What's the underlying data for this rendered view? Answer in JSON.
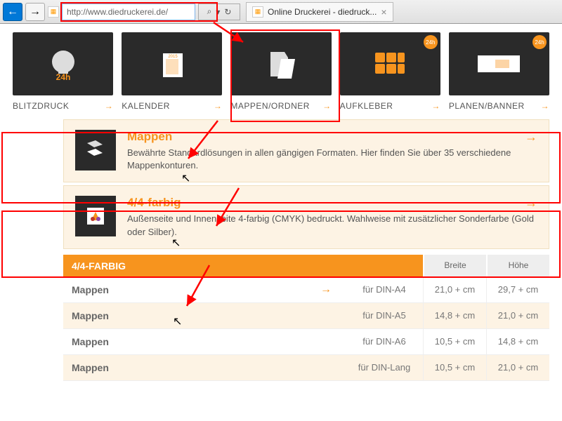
{
  "browser": {
    "url": "http://www.diedruckerei.de/",
    "search_hint": "⌕ ▾",
    "refresh": "↻",
    "tab_title": "Online Druckerei - diedruck..."
  },
  "categories": [
    {
      "label": "BLITZDRUCK"
    },
    {
      "label": "KALENDER"
    },
    {
      "label": "MAPPEN/ORDNER"
    },
    {
      "label": "AUFKLEBER"
    },
    {
      "label": "PLANEN/BANNER"
    }
  ],
  "cards": [
    {
      "title": "Mappen",
      "desc": "Bewährte Standardlösungen in allen gängigen Formaten. Hier finden Sie über 35 verschiedene Mappenkonturen."
    },
    {
      "title": "4/4-farbig",
      "desc": "Außenseite und Innenseite 4-farbig (CMYK) bedruckt. Wahlweise mit zusätzlicher Sonderfarbe (Gold oder Silber)."
    }
  ],
  "table": {
    "header_main": "4/4-FARBIG",
    "col_width": "Breite",
    "col_height": "Höhe",
    "rows": [
      {
        "name": "Mappen",
        "format": "für DIN-A4",
        "w": "21,0 + cm",
        "h": "29,7 + cm",
        "arrow": true
      },
      {
        "name": "Mappen",
        "format": "für DIN-A5",
        "w": "14,8 + cm",
        "h": "21,0 + cm"
      },
      {
        "name": "Mappen",
        "format": "für DIN-A6",
        "w": "10,5 + cm",
        "h": "14,8 + cm"
      },
      {
        "name": "Mappen",
        "format": "für DIN-Lang",
        "w": "10,5 + cm",
        "h": "21,0 + cm"
      }
    ]
  }
}
